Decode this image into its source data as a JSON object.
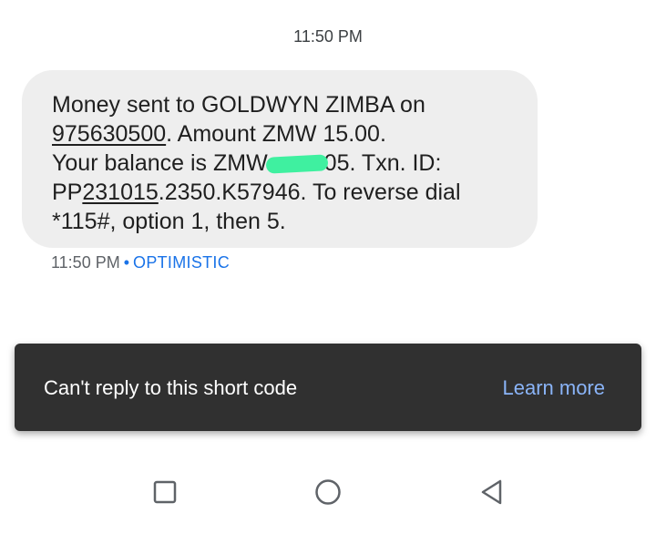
{
  "conversation": {
    "top_timestamp": "11:50 PM"
  },
  "message": {
    "line1": "Money sent to GOLDWYN ZIMBA on",
    "phone_number": "975630500",
    "line2_rest": ". Amount ZMW 15.00.",
    "line3_prefix": "Your balance is ZMW",
    "line3_suffix": "05. Txn. ID:",
    "txn_prefix": "PP",
    "txn_date": "231015",
    "txn_rest": ".2350.K57946. To reverse dial",
    "line5": "*115#, option 1, then 5.",
    "redaction_color": "#3ff0a0"
  },
  "message_meta": {
    "time": "11:50 PM",
    "separator": "•",
    "status": "OPTIMISTIC"
  },
  "snackbar": {
    "message": "Can't reply to this short code",
    "action": "Learn more"
  },
  "navigation_bar": {
    "recents_icon": "square-icon",
    "home_icon": "circle-icon",
    "back_icon": "triangle-back-icon"
  }
}
